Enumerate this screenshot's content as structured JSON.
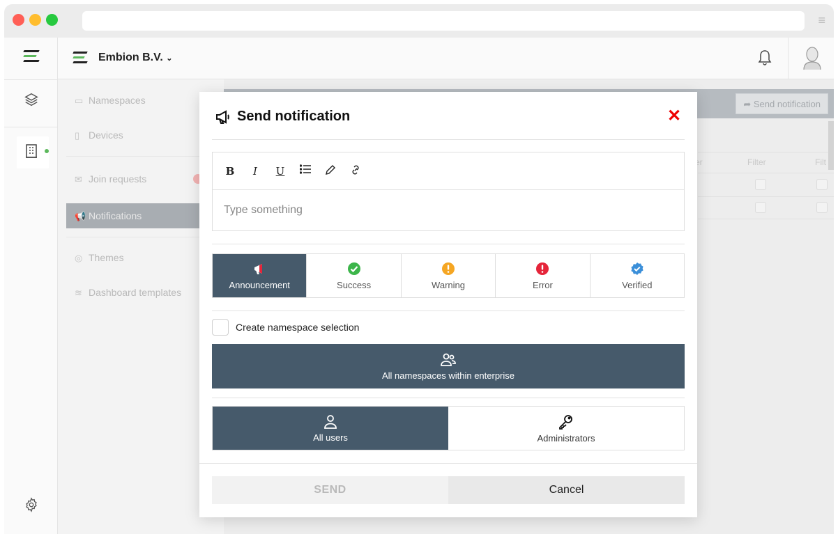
{
  "app": {
    "company_name": "Embion B.V."
  },
  "sidebar": {
    "items": [
      {
        "label": "Namespaces",
        "icon": "folder-icon"
      },
      {
        "label": "Devices",
        "icon": "device-icon"
      },
      {
        "label": "Join requests",
        "icon": "mail-icon"
      },
      {
        "label": "Notifications",
        "icon": "megaphone-icon",
        "active": true
      },
      {
        "label": "Themes",
        "icon": "palette-icon"
      },
      {
        "label": "Dashboard templates",
        "icon": "layers-icon"
      }
    ]
  },
  "background": {
    "send_notification_label": "Send notification",
    "filter_label": "Filter",
    "filter_partial_1": "er",
    "filter_partial_2": "Filt"
  },
  "modal": {
    "title": "Send notification",
    "editor": {
      "placeholder": "Type something",
      "toolbar": {
        "bold": "B",
        "italic": "I",
        "underline": "U"
      }
    },
    "types": [
      {
        "label": "Announcement",
        "active": true,
        "color": "#ffffff"
      },
      {
        "label": "Success",
        "color": "#3cb54a"
      },
      {
        "label": "Warning",
        "color": "#f5a623"
      },
      {
        "label": "Error",
        "color": "#e5253a"
      },
      {
        "label": "Verified",
        "color": "#3b8fd9"
      }
    ],
    "namespace_checkbox_label": "Create namespace selection",
    "namespace_scope_label": "All namespaces within enterprise",
    "audience": [
      {
        "label": "All users",
        "active": true
      },
      {
        "label": "Administrators"
      }
    ],
    "send_label": "SEND",
    "cancel_label": "Cancel"
  },
  "colors": {
    "accent_dark": "#465a6b",
    "close_red": "#ee0000"
  }
}
